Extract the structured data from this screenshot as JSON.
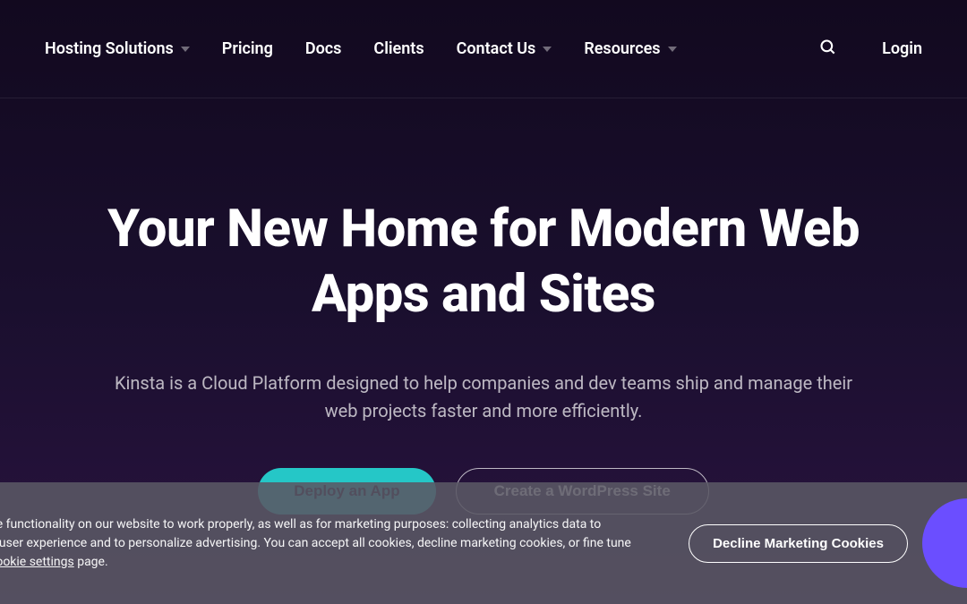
{
  "nav": {
    "items": [
      {
        "label": "Hosting Solutions",
        "dropdown": true
      },
      {
        "label": "Pricing",
        "dropdown": false
      },
      {
        "label": "Docs",
        "dropdown": false
      },
      {
        "label": "Clients",
        "dropdown": false
      },
      {
        "label": "Contact Us",
        "dropdown": true
      },
      {
        "label": "Resources",
        "dropdown": true
      }
    ],
    "login": "Login"
  },
  "hero": {
    "title": "Your New Home for Modern Web Apps and Sites",
    "subtitle": "Kinsta is a Cloud Platform designed to help companies and dev teams ship and manage their web projects faster and more efficiently.",
    "primaryCta": "Deploy an App",
    "secondaryCta": "Create a WordPress Site"
  },
  "cookieBanner": {
    "line1": "he functionality on our website to work properly, as well as for marketing purposes: collecting analytics data to",
    "line2": "e user experience and to personalize advertising. You can accept all cookies, decline marketing cookies, or fine tune",
    "link": "cookie settings",
    "line3suffix": " page.",
    "declineLabel": "Decline Marketing Cookies"
  }
}
